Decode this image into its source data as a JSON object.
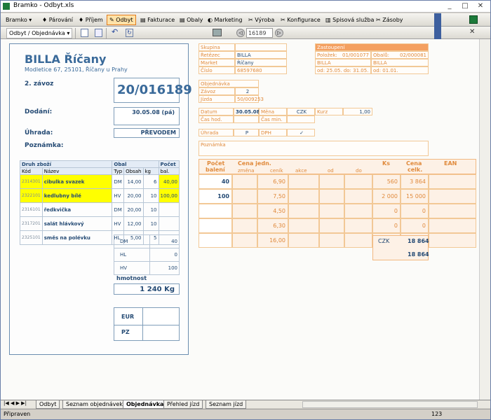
{
  "window": {
    "title": "Bramko - Odbyt.xls"
  },
  "menu": {
    "items": [
      "Bramko",
      "Párování",
      "Příjem",
      "Odbyt",
      "Fakturace",
      "Obaly",
      "Marketing",
      "Výroba",
      "Konfigurace",
      "Spisová služba",
      "Zásoby"
    ]
  },
  "toolbar2": {
    "dropdown": "Odbyt / Objednávka",
    "record": "16189"
  },
  "customer": {
    "name": "BILLA Říčany",
    "address": "Modletice 67, 25101, Říčany u Prahy",
    "zavoz": "2. závoz",
    "order_no": "20/016189",
    "dodani_label": "Dodání:",
    "dodani": "30.05.08 (pá)",
    "uhrada_label": "Úhrada:",
    "uhrada": "PŘEVODEM",
    "poznamka_label": "Poznámka:"
  },
  "goods": {
    "head": {
      "druh": "Druh zboží",
      "obal": "Obal",
      "pocet": "Počet",
      "kod": "Kód",
      "nazev": "Název",
      "typ": "Typ",
      "obsah": "Obsah",
      "kg": "kg",
      "bal": "bal."
    },
    "rows": [
      {
        "kod": "2314301",
        "nazev": "cibulka svazek",
        "typ": "DM",
        "obsah": "14,00",
        "kg": "6",
        "pocet": "40,00",
        "hl": true
      },
      {
        "kod": "2322101",
        "nazev": "kedlubny bílé",
        "typ": "HV",
        "obsah": "20,00",
        "kg": "10",
        "pocet": "100,00",
        "hl": true
      },
      {
        "kod": "2316101",
        "nazev": "ředkvička",
        "typ": "DM",
        "obsah": "20,00",
        "kg": "10",
        "pocet": "",
        "hl": false
      },
      {
        "kod": "2317201",
        "nazev": "salát hlávkový",
        "typ": "HV",
        "obsah": "12,00",
        "kg": "10",
        "pocet": "",
        "hl": false
      },
      {
        "kod": "2325101",
        "nazev": "směs na polévku",
        "typ": "HL",
        "obsah": "5,00",
        "kg": "5",
        "pocet": "",
        "hl": false
      }
    ],
    "totals": [
      {
        "t": "DM",
        "v": "40"
      },
      {
        "t": "HL",
        "v": "0"
      },
      {
        "t": "HV",
        "v": "100"
      }
    ],
    "weight_label": "hmotnost",
    "weight": "1 240 Kg",
    "eur": "EUR",
    "pz": "PZ"
  },
  "info": {
    "skupina": "Skupina",
    "retezec": "Řetězec",
    "retezec_v": "BILLA",
    "market": "Market",
    "market_v": "Říčany",
    "cislo": "Číslo",
    "cislo_v": "68597680",
    "zast": "Zastoupení",
    "polozek": "Položek:",
    "polozek_v": "01/001077",
    "obalu": "Obalů:",
    "obalu_v": "02/000081",
    "z1": "BILLA",
    "z2": "BILLA",
    "od1": "od: 25.05.",
    "do1": "do: 31.05.",
    "od2": "od: 01.01.",
    "objednavka": "Objednávka",
    "zavoz": "Závoz",
    "zavoz_v": "2",
    "jizda": "Jízda",
    "jizda_v": "50/009253",
    "datum": "Datum",
    "datum_v": "30.05.08",
    "mena": "Měna",
    "mena_v": "CZK",
    "kurz": "Kurz",
    "kurz_v": "1,00",
    "cashod": "Čas hod.",
    "casmin": "Čas min.",
    "uhrada": "Úhrada",
    "uhrada_v": "P",
    "dph": "DPH",
    "dph_v": "✓",
    "poznamka": "Poznámka"
  },
  "prices": {
    "h_pocet": "Počet",
    "h_baleni": "balení",
    "h_cena": "Cena jedn.",
    "h_zmena": "změna",
    "h_cenik": "ceník",
    "h_akce": "akce",
    "h_od": "od",
    "h_do": "do",
    "h_ks": "Ks",
    "h_cena2": "Cena",
    "h_colk": "celk.",
    "h_ean": "EAN",
    "rows": [
      {
        "p": "40",
        "c": "6,90",
        "ks": "560",
        "cc": "3 864"
      },
      {
        "p": "100",
        "c": "7,50",
        "ks": "2 000",
        "cc": "15 000"
      },
      {
        "p": "",
        "c": "4,50",
        "ks": "0",
        "cc": "0"
      },
      {
        "p": "",
        "c": "6,30",
        "ks": "0",
        "cc": "0"
      },
      {
        "p": "",
        "c": "16,00",
        "ks": "0",
        "cc": "0"
      }
    ],
    "czk": "CZK",
    "sum1": "18 864",
    "sum2": "18 864"
  },
  "tabs": [
    "Odbyt",
    "Seznam objednávek",
    "Objednávka",
    "Přehled jízd",
    "Seznam jízd"
  ],
  "status": {
    "left": "Připraven",
    "right": "123"
  }
}
